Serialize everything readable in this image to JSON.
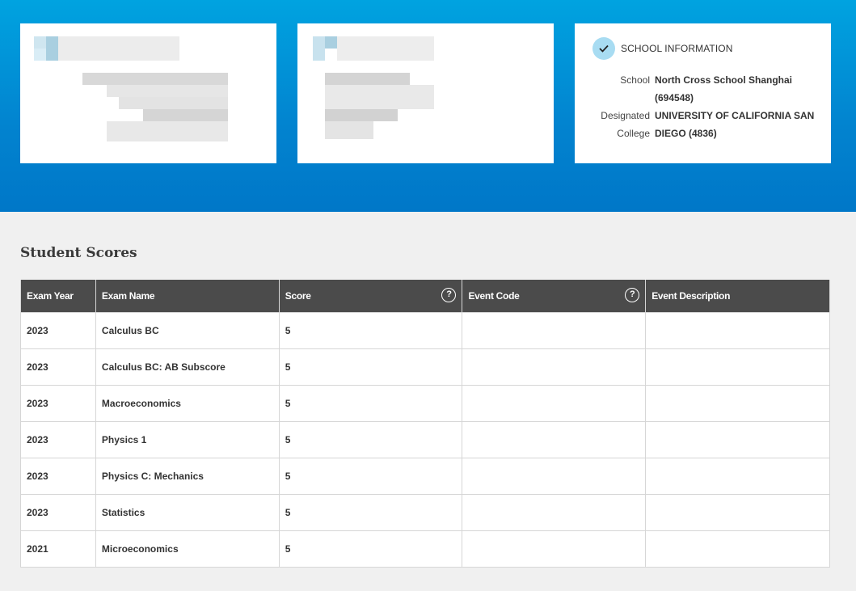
{
  "school_info": {
    "title": "SCHOOL INFORMATION",
    "rows": [
      {
        "label": "School",
        "value": "North Cross School Shanghai"
      },
      {
        "label": "",
        "value": "(694548)"
      },
      {
        "label": "Designated",
        "value": "UNIVERSITY OF CALIFORNIA SAN"
      },
      {
        "label": "College",
        "value": "DIEGO (4836)"
      }
    ],
    "icon": "check-icon"
  },
  "scores": {
    "title": "Student Scores",
    "columns": [
      "Exam Year",
      "Exam Name",
      "Score",
      "Event Code",
      "Event Description"
    ],
    "help_icon": "question-circle-icon",
    "rows": [
      {
        "year": "2023",
        "name": "Calculus BC",
        "score": "5",
        "event_code": "",
        "event_description": ""
      },
      {
        "year": "2023",
        "name": "Calculus BC: AB Subscore",
        "score": "5",
        "event_code": "",
        "event_description": ""
      },
      {
        "year": "2023",
        "name": "Macroeconomics",
        "score": "5",
        "event_code": "",
        "event_description": ""
      },
      {
        "year": "2023",
        "name": "Physics 1",
        "score": "5",
        "event_code": "",
        "event_description": ""
      },
      {
        "year": "2023",
        "name": "Physics C: Mechanics",
        "score": "5",
        "event_code": "",
        "event_description": ""
      },
      {
        "year": "2023",
        "name": "Statistics",
        "score": "5",
        "event_code": "",
        "event_description": ""
      },
      {
        "year": "2021",
        "name": "Microeconomics",
        "score": "5",
        "event_code": "",
        "event_description": ""
      }
    ]
  },
  "colors": {
    "band_top": "#00a3e0",
    "band_bottom": "#0077c8",
    "table_header": "#4b4b4b",
    "check_circle": "#a8dcf2"
  }
}
